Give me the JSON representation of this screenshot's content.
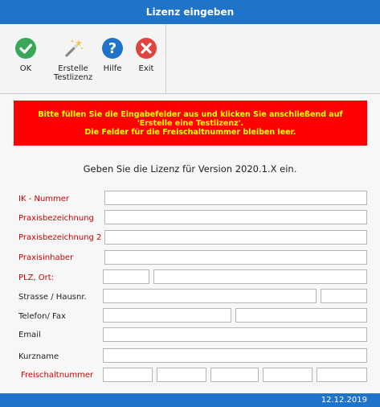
{
  "window": {
    "title": "Lizenz eingeben"
  },
  "toolbar": {
    "buttons": [
      {
        "label": "OK",
        "icon": "check-icon",
        "color": "#3aa657"
      },
      {
        "label": "Erstelle\nTestlizenz",
        "icon": "magic-wand-icon",
        "color": "#888888"
      },
      {
        "label": "Hilfe",
        "icon": "help-icon",
        "color": "#1f74c9"
      },
      {
        "label": "Exit",
        "icon": "close-icon",
        "color": "#e0443e"
      }
    ]
  },
  "banner": {
    "text": "Bitte füllen Sie die Eingabefelder aus und klicken Sie anschließend auf\n'Erstelle eine Testlizenz'.\nDie Felder für die Freischaltnummer bleiben leer.",
    "background": "#ff0000",
    "color": "#ffff00"
  },
  "heading": "Geben Sie die Lizenz für Version 2020.1.X ein.",
  "form": {
    "labels": {
      "ik_nummer": "IK - Nummer",
      "praxisbezeichnung": "Praxisbezeichnung",
      "praxisbezeichnung2": "Praxisbezeichnung 2",
      "praxisinhaber": "Praxisinhaber",
      "plz_ort": "PLZ, Ort:",
      "strasse": "Strasse / Hausnr.",
      "telefon_fax": "Telefon/ Fax",
      "email": "Email",
      "kurzname": "Kurzname",
      "freischaltnummer": "Freischaltnummer"
    },
    "values": {
      "ik_nummer": "",
      "praxisbezeichnung": "",
      "praxisbezeichnung2": "",
      "praxisinhaber": "",
      "plz": "",
      "ort": "",
      "strasse": "",
      "hausnr": "",
      "telefon": "",
      "fax": "",
      "email": "",
      "kurzname": "",
      "freischalt1": "",
      "freischalt2": "",
      "freischalt3": "",
      "freischalt4": "",
      "freischalt5": ""
    }
  },
  "footer": {
    "date": "12.12.2019"
  },
  "colors": {
    "titlebar": "#1f74c9",
    "required_label": "#d00000"
  }
}
